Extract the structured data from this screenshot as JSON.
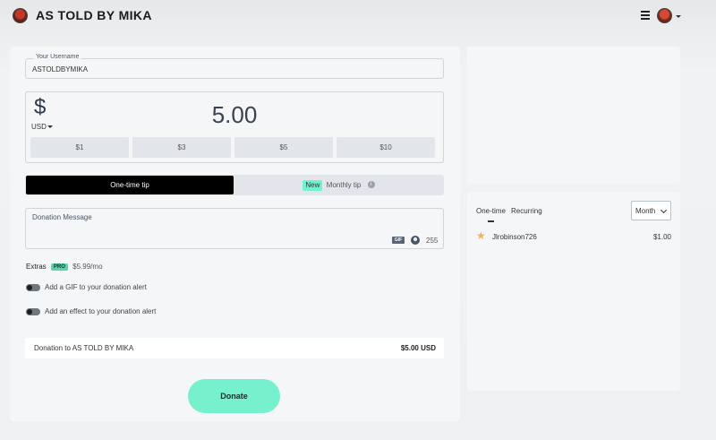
{
  "header": {
    "title": "AS TOLD BY MIKA",
    "menu_icon": "hamburger-menu-icon",
    "avatar_icon": "user-avatar"
  },
  "form": {
    "username_label": "Your Username",
    "username_value": "ASTOLDBYMIKA",
    "currency_symbol": "$",
    "currency_code": "USD",
    "amount": "5.00",
    "presets": [
      "$1",
      "$3",
      "$5",
      "$10"
    ],
    "tip_onetime": "One-time tip",
    "tip_new_badge": "New",
    "tip_monthly": "Monthly tip",
    "message_label": "Donation Message",
    "gif_label": "GIF",
    "char_count": "255",
    "extras_label": "Extras",
    "extras_badge": "PRO",
    "extras_price": "$5.99/mo",
    "toggle_gif": "Add a GIF to your donation alert",
    "toggle_effect": "Add an effect to your donation alert",
    "summary_label": "Donation to AS TOLD BY MIKA",
    "summary_amount": "$5.00 USD",
    "donate_label": "Donate"
  },
  "sidebar": {
    "tabs": [
      "One-time",
      "Recurring"
    ],
    "period": "Month",
    "donors": [
      {
        "name": "Jlrobinson726",
        "amount": "$1.00"
      }
    ]
  },
  "colors": {
    "accent": "#76f0cd",
    "active_tab": "#000000",
    "panel": "#f4f6f8"
  }
}
